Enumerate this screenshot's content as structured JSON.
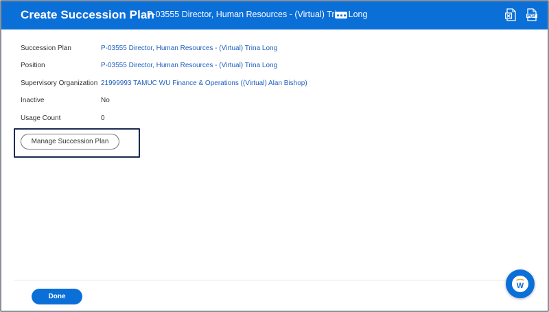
{
  "header": {
    "title": "Create Succession Plan",
    "subtitle": "P-03555 Director, Human Resources - (Virtual) Trina Long",
    "accent_color": "#0b6fd8",
    "icons": [
      "more-options-icon",
      "export-excel-icon",
      "export-pdf-icon"
    ]
  },
  "fields": [
    {
      "label": "Succession Plan",
      "value": "P-03555 Director, Human Resources - (Virtual) Trina Long"
    },
    {
      "label": "Position",
      "value": "P-03555 Director, Human Resources - (Virtual) Trina Long"
    },
    {
      "label": "Supervisory Organization",
      "value": "21999993 TAMUC WU Finance & Operations ((Virtual) Alan Bishop)"
    },
    {
      "label": "Inactive",
      "value": "No"
    },
    {
      "label": "Usage Count",
      "value": "0"
    }
  ],
  "buttons": {
    "manage": "Manage Succession Plan",
    "done": "Done"
  },
  "assistant": {
    "glyph": "W"
  }
}
